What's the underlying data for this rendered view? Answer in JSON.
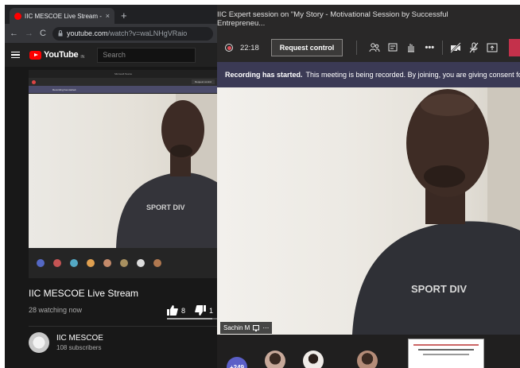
{
  "browser": {
    "tab_title": "IIC MESCOE Live Stream - YouTube",
    "tab_close": "×",
    "new_tab": "+",
    "url_host": "youtube.com",
    "url_path": "/watch?v=waLNHgVRaio"
  },
  "youtube": {
    "logo_text": "YouTube",
    "logo_region": "IN",
    "search_placeholder": "Search",
    "video_title": "IIC MESCOE Live Stream",
    "watching": "28 watching now",
    "likes": "8",
    "dislikes": "1",
    "like_ratio": 0.89,
    "channel_name": "IIC MESCOE",
    "subscribers": "108 subscribers"
  },
  "teams": {
    "meeting_title": "IIC Expert session on \"My Story - Motivational Session by Successful Entrepreneu...",
    "elapsed_time": "22:18",
    "request_control_label": "Request control",
    "recording_bold": "Recording has started.",
    "recording_text": "This meeting is being recorded. By joining, you are giving consent for this m...",
    "speaker_name": "Sachin M",
    "speaker_more": "⋯",
    "participants_more": "+249",
    "shirt_text": "SPORT DIV"
  },
  "colors": {
    "youtube_red": "#ff0000",
    "teams_recording_banner": "#3b3a55",
    "teams_hangup": "#c4314b",
    "teams_more_badge": "#5b5fc7"
  },
  "icons": {
    "controls": [
      "people-icon",
      "chat-icon",
      "raise-hand-icon",
      "more-icon",
      "camera-off-icon",
      "mic-off-icon",
      "share-tray-icon"
    ]
  }
}
